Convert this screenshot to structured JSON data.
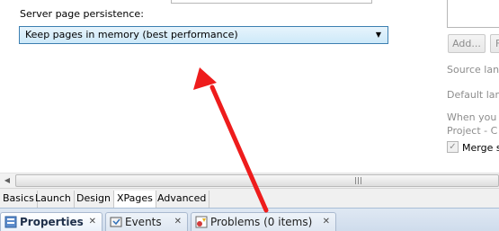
{
  "server_page": {
    "label": "Server page persistence:",
    "selected_option": "Keep pages in memory (best performance)"
  },
  "right_panel": {
    "add_button_label": "Add...",
    "second_button_label": "F",
    "source_lang_text": "Source lang",
    "default_lang_text": "Default lan",
    "when_text": "When you",
    "project_text": "Project - C",
    "merge_label": "Merge s",
    "merge_checked": true
  },
  "sub_tabs": [
    {
      "label": "Basics"
    },
    {
      "label": "Launch"
    },
    {
      "label": "Design"
    },
    {
      "label": "XPages"
    },
    {
      "label": "Advanced"
    }
  ],
  "active_sub_tab": "XPages",
  "view_tabs": [
    {
      "label": "Properties",
      "icon": "properties-icon",
      "active": true
    },
    {
      "label": "Events",
      "icon": "events-icon",
      "active": false
    },
    {
      "label": "Problems (0 items)",
      "icon": "problems-icon",
      "active": false
    }
  ],
  "close_glyph": "✕",
  "colors": {
    "arrow": "#ee1c1c",
    "select_border": "#3c7fb1",
    "view_tab_bar": "#cfdcec"
  }
}
